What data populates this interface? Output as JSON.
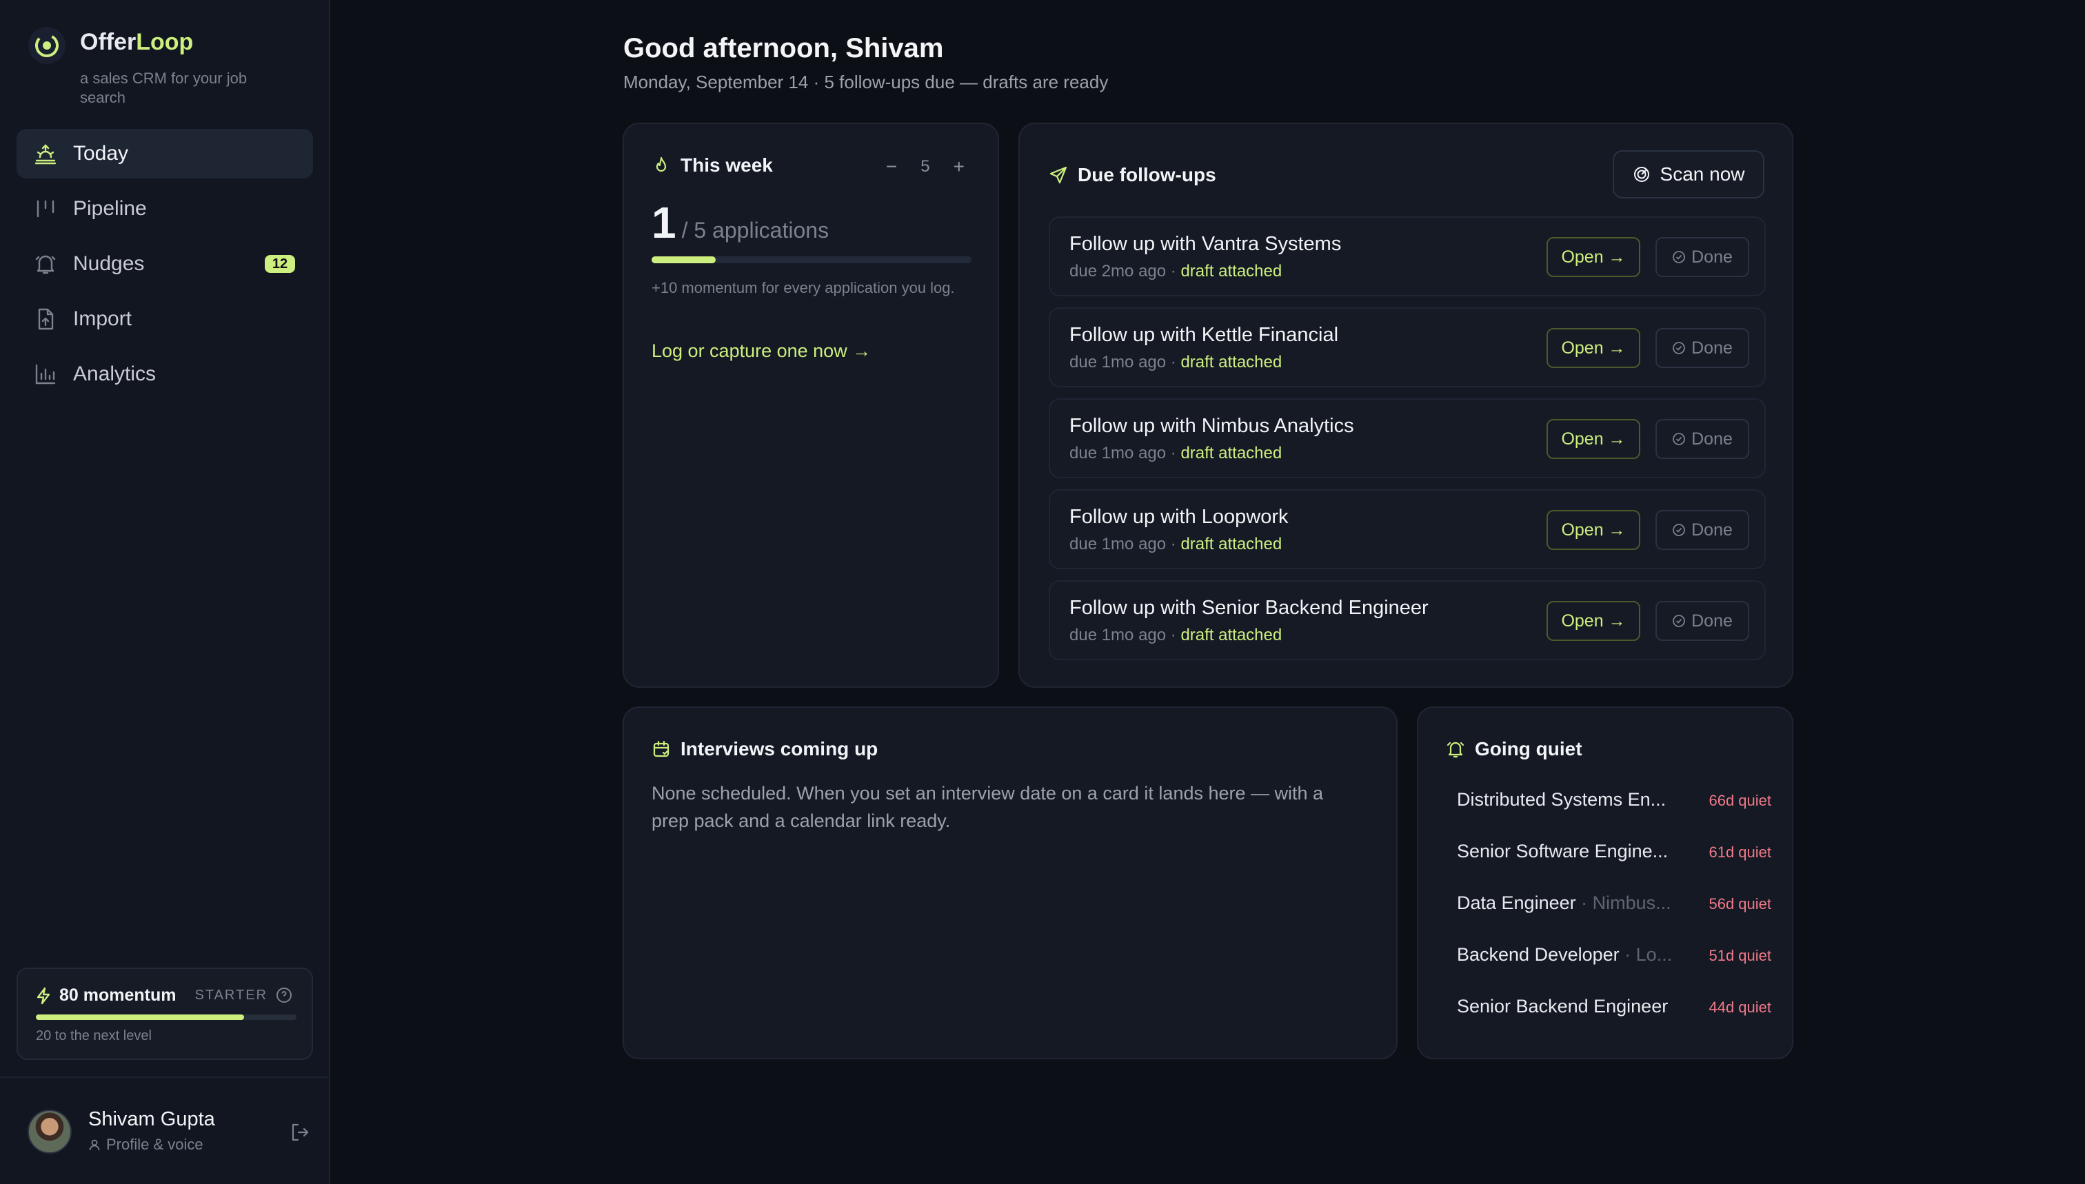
{
  "app": {
    "name_part1": "Offer",
    "name_part2": "Loop",
    "tagline": "a sales CRM for your job search"
  },
  "nav": [
    {
      "label": "Today",
      "icon": "sunrise-icon",
      "active": true
    },
    {
      "label": "Pipeline",
      "icon": "columns-icon"
    },
    {
      "label": "Nudges",
      "icon": "bell-icon",
      "badge": "12"
    },
    {
      "label": "Import",
      "icon": "file-upload-icon"
    },
    {
      "label": "Analytics",
      "icon": "bar-chart-icon"
    }
  ],
  "momentum": {
    "title": "80 momentum",
    "tier": "STARTER",
    "progress": 0.8,
    "next": "20 to the next level"
  },
  "profile": {
    "name": "Shivam Gupta",
    "sub": "Profile & voice"
  },
  "header": {
    "greeting": "Good afternoon, Shivam",
    "subline": "Monday, September 14 · 5 follow-ups due — drafts are ready"
  },
  "week": {
    "title": "This week",
    "minus": "−",
    "goal": "5",
    "plus": "+",
    "count": "1",
    "of": "/ 5 applications",
    "progress": 0.2,
    "note": "+10 momentum for every application you log.",
    "cta": "Log or capture one now →"
  },
  "followups": {
    "title": "Due follow-ups",
    "scan_label": "Scan now",
    "open_label": "Open →",
    "done_label": "Done",
    "items": [
      {
        "title": "Follow up with Vantra Systems",
        "due": "due 2mo ago ·",
        "draft": "draft attached"
      },
      {
        "title": "Follow up with Kettle Financial",
        "due": "due 1mo ago ·",
        "draft": "draft attached"
      },
      {
        "title": "Follow up with Nimbus Analytics",
        "due": "due 1mo ago ·",
        "draft": "draft attached"
      },
      {
        "title": "Follow up with Loopwork",
        "due": "due 1mo ago ·",
        "draft": "draft attached"
      },
      {
        "title": "Follow up with Senior Backend Engineer",
        "due": "due 1mo ago ·",
        "draft": "draft attached"
      }
    ]
  },
  "interviews": {
    "title": "Interviews coming up",
    "body": "None scheduled. When you set an interview date on a card it lands here — with a prep pack and a calendar link ready."
  },
  "quiet": {
    "title": "Going quiet",
    "items": [
      {
        "role": "Distributed Systems En...",
        "company": "",
        "days": "66d quiet"
      },
      {
        "role": "Senior Software Engine...",
        "company": "",
        "days": "61d quiet"
      },
      {
        "role": "Data Engineer",
        "company": "· Nimbus...",
        "days": "56d quiet"
      },
      {
        "role": "Backend Developer",
        "company": "· Lo...",
        "days": "51d quiet"
      },
      {
        "role": "Senior Backend Engineer",
        "company": "",
        "days": "44d quiet"
      }
    ]
  },
  "colors": {
    "accent": "#cdef7f",
    "background": "#0c0f16",
    "card": "#141923",
    "quiet": "#f07a8a"
  }
}
